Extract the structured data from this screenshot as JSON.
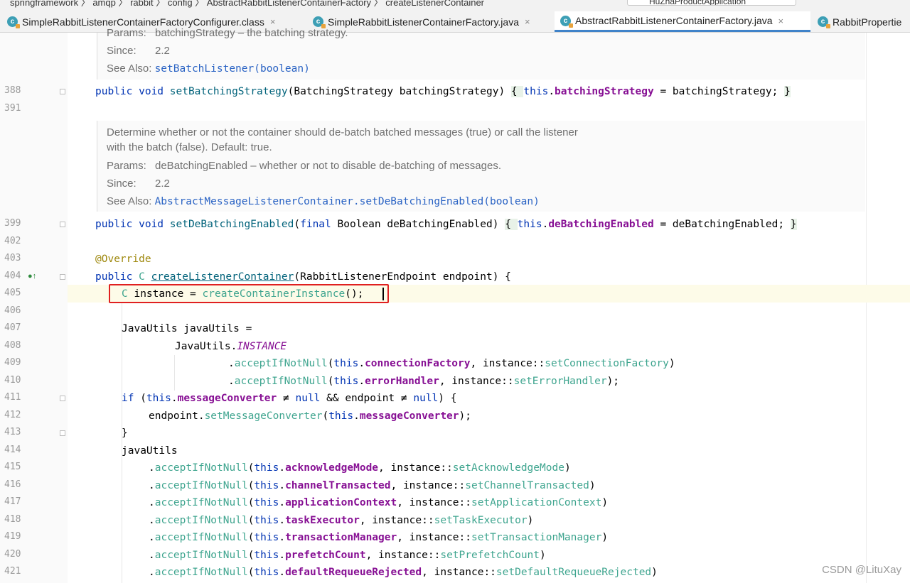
{
  "breadcrumbs": [
    "springframework",
    "amqp",
    "rabbit",
    "config",
    "AbstractRabbitListenerContainerFactory",
    "createListenerContainer"
  ],
  "run_config": "HuZhaProductApplication",
  "tabs": [
    {
      "label": "SimpleRabbitListenerContainerFactoryConfigurer.class",
      "close": "×"
    },
    {
      "label": "SimpleRabbitListenerContainerFactory.java",
      "close": "×"
    },
    {
      "label": "AbstractRabbitListenerContainerFactory.java",
      "close": "×"
    },
    {
      "label": "RabbitPropertie"
    }
  ],
  "doc1": {
    "params_label": "Params:",
    "params_text": "batchingStrategy – the batching strategy.",
    "since_label": "Since:",
    "since_value": "2.2",
    "seealso_label": "See Also:",
    "seealso_link": "setBatchListener(boolean)"
  },
  "doc2": {
    "line1": "Determine whether or not the container should de-batch batched messages (true) or call the listener",
    "line2": "with the batch (false). Default: true.",
    "params_label": "Params:",
    "params_text": "deBatchingEnabled – whether or not to disable de-batching of messages.",
    "since_label": "Since:",
    "since_value": "2.2",
    "seealso_label": "See Also:",
    "seealso_link": "AbstractMessageListenerContainer.setDeBatchingEnabled(boolean)"
  },
  "line_numbers": [
    "388",
    "391",
    "399",
    "402",
    "403",
    "404",
    "405",
    "406",
    "407",
    "408",
    "409",
    "410",
    "411",
    "412",
    "413",
    "414",
    "415",
    "416",
    "417",
    "418",
    "419",
    "420",
    "421"
  ],
  "watermark": "CSDN @LituXay"
}
